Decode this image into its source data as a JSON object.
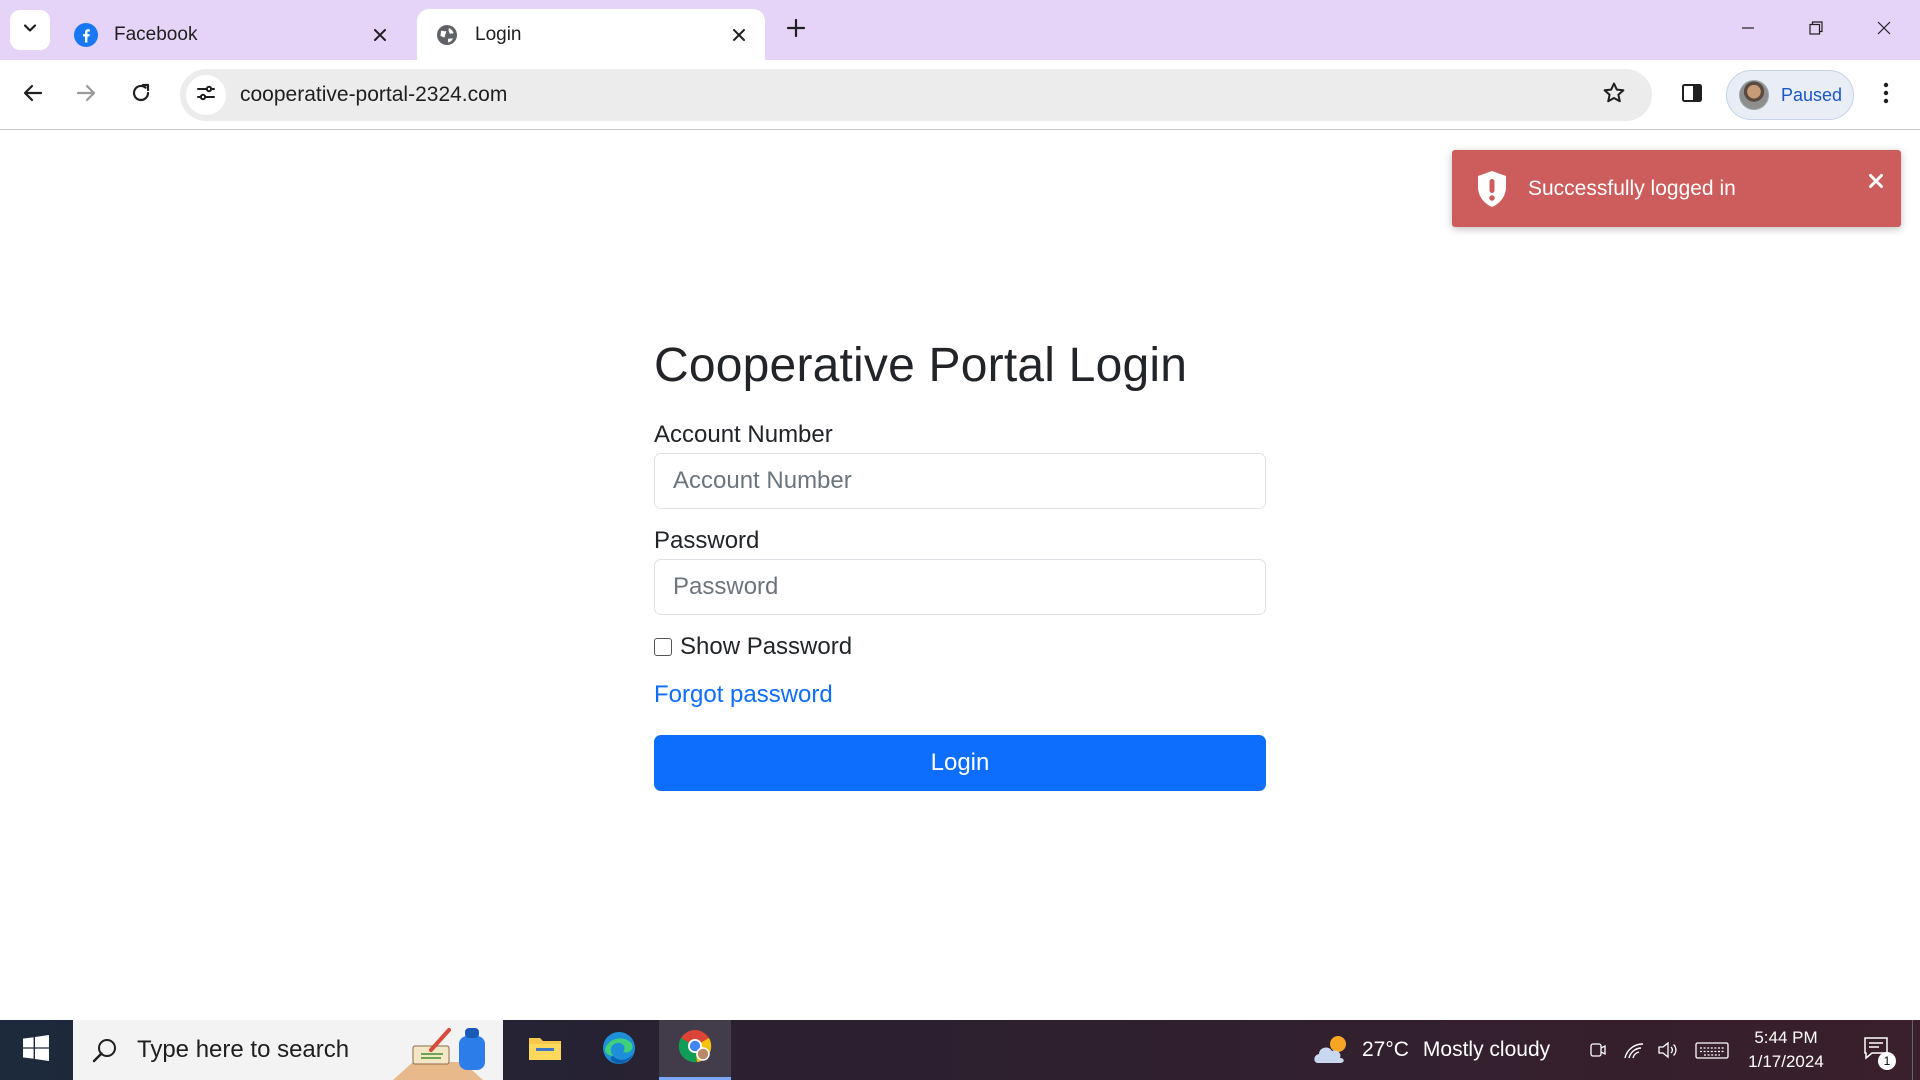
{
  "browser": {
    "tabs": [
      {
        "title": "Facebook",
        "icon": "facebook-icon",
        "active": false
      },
      {
        "title": "Login",
        "icon": "globe-icon",
        "active": true
      }
    ],
    "url": "cooperative-portal-2324.com",
    "profile_label": "Paused"
  },
  "page": {
    "title": "Cooperative Portal Login",
    "account_label": "Account Number",
    "account_placeholder": "Account Number",
    "account_value": "",
    "password_label": "Password",
    "password_placeholder": "Password",
    "password_value": "",
    "show_password_label": "Show Password",
    "show_password_checked": false,
    "forgot_link": "Forgot password",
    "login_button": "Login"
  },
  "toast": {
    "message": "Successfully logged in",
    "color": "#cd5c5c"
  },
  "taskbar": {
    "search_placeholder": "Type here to search",
    "weather_temp": "27°C",
    "weather_desc": "Mostly cloudy",
    "time": "5:44 PM",
    "date": "1/17/2024",
    "notification_count": "1"
  },
  "colors": {
    "accent": "#0d6efd",
    "tabstrip": "#e6d4f8",
    "profile_text": "#1a56c4"
  }
}
